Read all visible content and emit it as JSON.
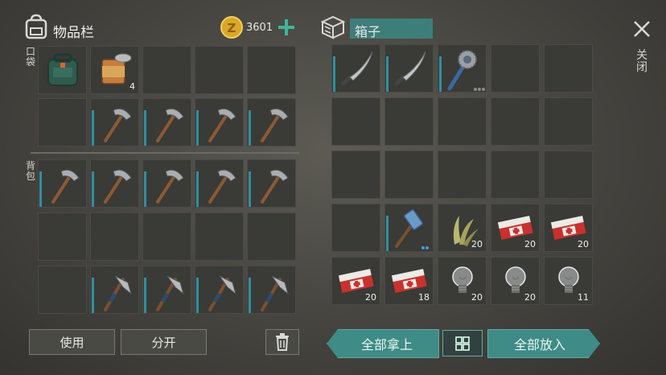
{
  "inventory": {
    "title": "物品栏",
    "coins": "3601",
    "pocket_label": "口袋",
    "backpack_label": "背包"
  },
  "chest": {
    "title": "箱子"
  },
  "close_label": "关闭",
  "buttons": {
    "use": "使用",
    "split": "分开",
    "take_all": "全部拿上",
    "put_all": "全部放入"
  },
  "pocket_slots": [
    {
      "item": "backpack-icon"
    },
    {
      "item": "canned-food-icon",
      "count": "4"
    },
    {},
    {},
    {},
    {},
    {
      "item": "pickaxe-icon"
    },
    {
      "item": "pickaxe-icon"
    },
    {
      "item": "pickaxe-icon"
    },
    {
      "item": "pickaxe-icon"
    }
  ],
  "backpack_slots": [
    {
      "item": "pickaxe-icon"
    },
    {
      "item": "pickaxe-icon"
    },
    {
      "item": "pickaxe-icon"
    },
    {
      "item": "pickaxe-icon"
    },
    {
      "item": "pickaxe-icon"
    },
    {},
    {},
    {},
    {},
    {},
    {},
    {
      "item": "axe-icon"
    },
    {
      "item": "axe-icon"
    },
    {
      "item": "axe-icon"
    },
    {
      "item": "axe-icon"
    }
  ],
  "chest_slots": [
    {
      "item": "machete-icon"
    },
    {
      "item": "machete-icon"
    },
    {
      "item": "spiked-club-icon"
    },
    {},
    {},
    {},
    {},
    {},
    {},
    {},
    {},
    {},
    {},
    {},
    {},
    {},
    {
      "item": "hammer-icon"
    },
    {
      "item": "plant-fiber-icon",
      "count": "20"
    },
    {
      "item": "medkit-icon",
      "count": "20"
    },
    {
      "item": "medkit-icon",
      "count": "20"
    },
    {
      "item": "medkit-icon",
      "count": "20"
    },
    {
      "item": "medkit-icon",
      "count": "18"
    },
    {
      "item": "lightbulb-icon",
      "count": "20"
    },
    {
      "item": "lightbulb-icon",
      "count": "20"
    },
    {
      "item": "lightbulb-icon",
      "count": "11"
    }
  ]
}
